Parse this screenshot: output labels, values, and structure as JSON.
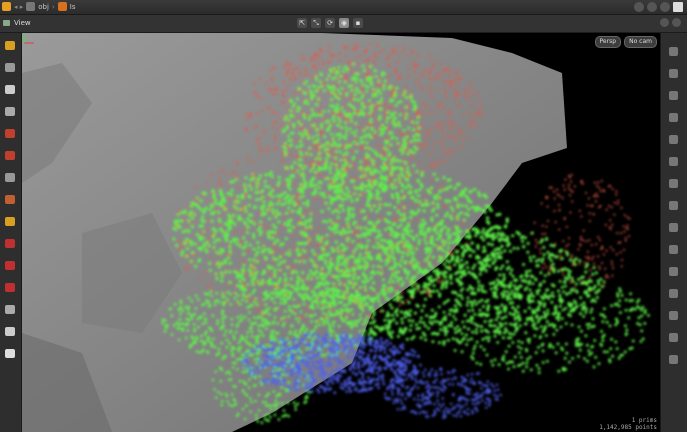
{
  "topbar": {
    "path": [
      "obj",
      "Is"
    ],
    "right_icons": [
      "globe-icon",
      "cloud-icon",
      "user-icon",
      "window-icon"
    ]
  },
  "viewbar": {
    "title": "View",
    "tools": [
      {
        "name": "select-tool",
        "glyph": "⇱"
      },
      {
        "name": "move-tool",
        "glyph": "⤡"
      },
      {
        "name": "rotate-tool",
        "glyph": "⟳"
      },
      {
        "name": "display-toggle",
        "glyph": "◉"
      },
      {
        "name": "snap-toggle",
        "glyph": "▪"
      }
    ]
  },
  "viewport": {
    "camera_menu": "Persp",
    "cam_menu": "No cam",
    "stats_line1": "1  prims",
    "stats_line2": "1,142,985  points"
  },
  "colors": {
    "ground": "#8a8a8a",
    "points_green": "#5ef04a",
    "points_red": "#e05a48",
    "points_blue": "#5060f0",
    "background": "#000000"
  },
  "left_tools": [
    "select-icon",
    "pointer-icon",
    "view-icon",
    "transform-icon",
    "pose-icon",
    "handle-icon",
    "snap-icon",
    "light-icon",
    "render-icon",
    "magnet-icon",
    "paint-icon",
    "camera-icon",
    "grid-icon",
    "group-icon",
    "lasso-icon"
  ],
  "right_tools": [
    "display-icon",
    "shade-icon",
    "wire-icon",
    "lights-icon",
    "visibility-icon",
    "normals-icon",
    "points-icon",
    "ghost-icon",
    "template-icon",
    "xray-icon",
    "background-icon",
    "uv-icon",
    "scale-icon",
    "grid-display-icon",
    "info-icon"
  ]
}
